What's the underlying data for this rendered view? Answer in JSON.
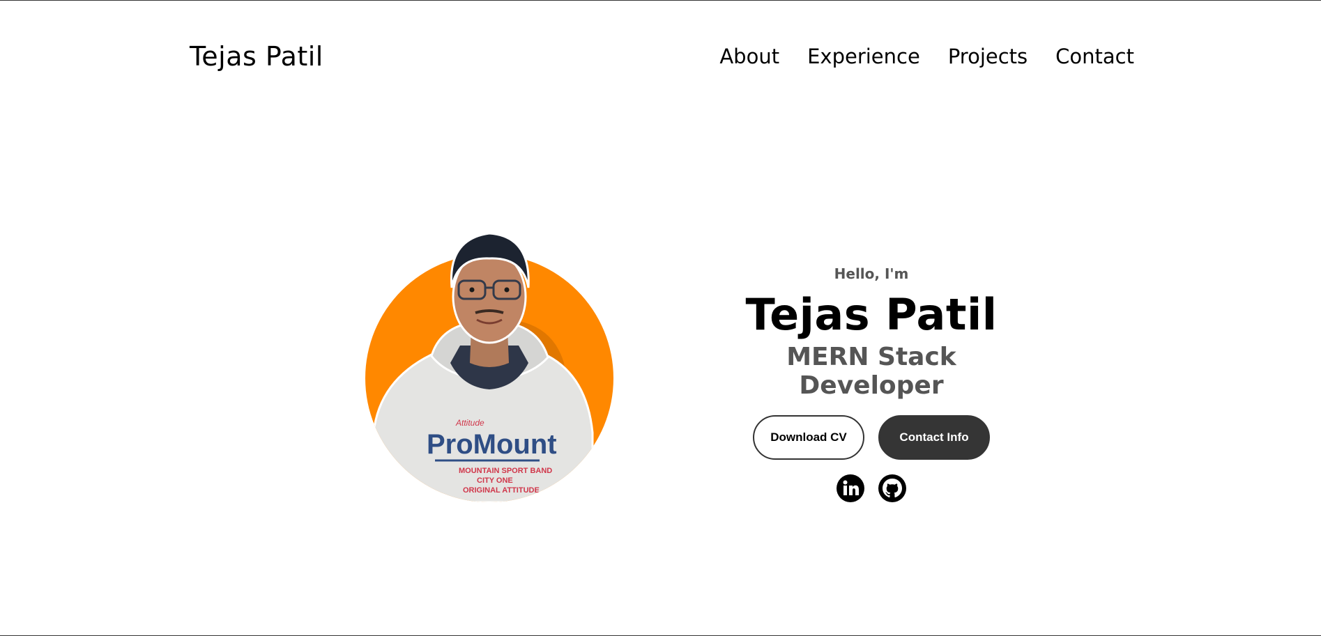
{
  "nav": {
    "logo": "Tejas Patil",
    "links": [
      {
        "label": "About"
      },
      {
        "label": "Experience"
      },
      {
        "label": "Projects"
      },
      {
        "label": "Contact"
      }
    ]
  },
  "profile": {
    "greeting": "Hello, I'm",
    "name": "Tejas Patil",
    "title": "MERN Stack Developer",
    "buttons": {
      "download_cv": "Download CV",
      "contact_info": "Contact Info"
    },
    "photo": {
      "shirt_text": "ProMount",
      "shirt_small": "Attitude",
      "shirt_lines": [
        "MOUNTAIN SPORT BAND",
        "CITY ONE",
        "ORIGINAL ATTITUDE"
      ]
    },
    "socials": [
      "linkedin-icon",
      "github-icon"
    ]
  },
  "colors": {
    "accent_circle": "#ff8800",
    "solid_button": "#353535",
    "muted_text": "#555555"
  }
}
